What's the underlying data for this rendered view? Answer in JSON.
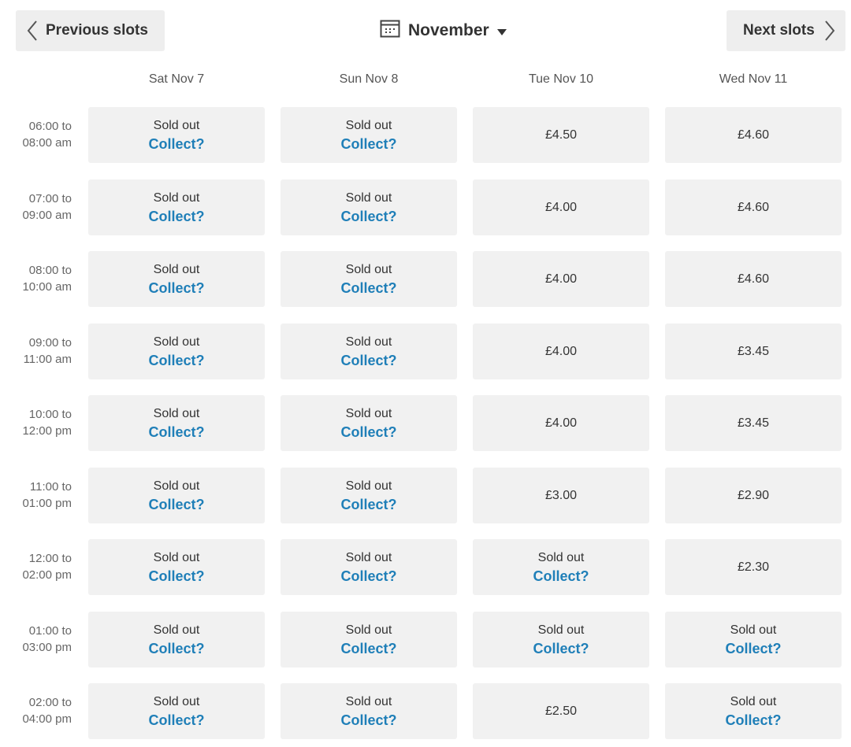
{
  "nav": {
    "prev_label": "Previous slots",
    "next_label": "Next slots",
    "month_label": "November"
  },
  "icons": {
    "prev": "chevron-left-icon",
    "next": "chevron-right-icon",
    "calendar": "calendar-icon",
    "caret": "caret-down-icon"
  },
  "colors": {
    "collect_link": "#1f7fb8",
    "slot_bg": "#f1f1f1",
    "button_bg": "#eeeeee"
  },
  "days": [
    "Sat Nov 7",
    "Sun Nov 8",
    "Tue Nov 10",
    "Wed Nov 11"
  ],
  "sold_out_label": "Sold out",
  "collect_label": "Collect?",
  "rows": [
    {
      "time_line1": "06:00 to",
      "time_line2": "08:00 am",
      "slots": [
        {
          "status": "sold_out"
        },
        {
          "status": "sold_out"
        },
        {
          "status": "available",
          "price": "£4.50"
        },
        {
          "status": "available",
          "price": "£4.60"
        }
      ]
    },
    {
      "time_line1": "07:00 to",
      "time_line2": "09:00 am",
      "slots": [
        {
          "status": "sold_out"
        },
        {
          "status": "sold_out"
        },
        {
          "status": "available",
          "price": "£4.00"
        },
        {
          "status": "available",
          "price": "£4.60"
        }
      ]
    },
    {
      "time_line1": "08:00 to",
      "time_line2": "10:00 am",
      "slots": [
        {
          "status": "sold_out"
        },
        {
          "status": "sold_out"
        },
        {
          "status": "available",
          "price": "£4.00"
        },
        {
          "status": "available",
          "price": "£4.60"
        }
      ]
    },
    {
      "time_line1": "09:00 to",
      "time_line2": "11:00 am",
      "slots": [
        {
          "status": "sold_out"
        },
        {
          "status": "sold_out"
        },
        {
          "status": "available",
          "price": "£4.00"
        },
        {
          "status": "available",
          "price": "£3.45"
        }
      ]
    },
    {
      "time_line1": "10:00 to",
      "time_line2": "12:00 pm",
      "slots": [
        {
          "status": "sold_out"
        },
        {
          "status": "sold_out"
        },
        {
          "status": "available",
          "price": "£4.00"
        },
        {
          "status": "available",
          "price": "£3.45"
        }
      ]
    },
    {
      "time_line1": "11:00 to",
      "time_line2": "01:00 pm",
      "slots": [
        {
          "status": "sold_out"
        },
        {
          "status": "sold_out"
        },
        {
          "status": "available",
          "price": "£3.00"
        },
        {
          "status": "available",
          "price": "£2.90"
        }
      ]
    },
    {
      "time_line1": "12:00 to",
      "time_line2": "02:00 pm",
      "slots": [
        {
          "status": "sold_out"
        },
        {
          "status": "sold_out"
        },
        {
          "status": "sold_out"
        },
        {
          "status": "available",
          "price": "£2.30"
        }
      ]
    },
    {
      "time_line1": "01:00 to",
      "time_line2": "03:00 pm",
      "slots": [
        {
          "status": "sold_out"
        },
        {
          "status": "sold_out"
        },
        {
          "status": "sold_out"
        },
        {
          "status": "sold_out"
        }
      ]
    },
    {
      "time_line1": "02:00 to",
      "time_line2": "04:00 pm",
      "slots": [
        {
          "status": "sold_out"
        },
        {
          "status": "sold_out"
        },
        {
          "status": "available",
          "price": "£2.50"
        },
        {
          "status": "sold_out"
        }
      ]
    }
  ]
}
